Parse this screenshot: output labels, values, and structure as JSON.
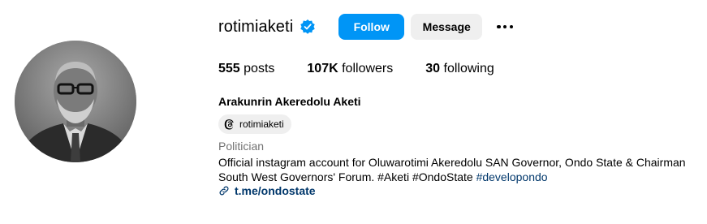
{
  "profile": {
    "username": "rotimiaketi",
    "verified": true,
    "full_name": "Arakunrin Akeredolu Aketi",
    "threads_handle": "rotimiaketi",
    "category": "Politician",
    "bio_line1": "Official instagram account for Oluwarotimi Akeredolu SAN Governor, Ondo State & Chairman",
    "bio_line2_text": "South West Governors' Forum. #Aketi #OndoState ",
    "bio_hashtag": "#developondo",
    "link": "t.me/ondostate"
  },
  "actions": {
    "follow_label": "Follow",
    "message_label": "Message",
    "more_icon": "more-horizontal-icon"
  },
  "stats": {
    "posts_count": "555",
    "posts_label": "posts",
    "followers_count": "107K",
    "followers_label": "followers",
    "following_count": "30",
    "following_label": "following"
  },
  "colors": {
    "accent": "#0095f6",
    "link": "#00376b",
    "secondary_text": "#737373",
    "button_gray": "#efefef"
  }
}
